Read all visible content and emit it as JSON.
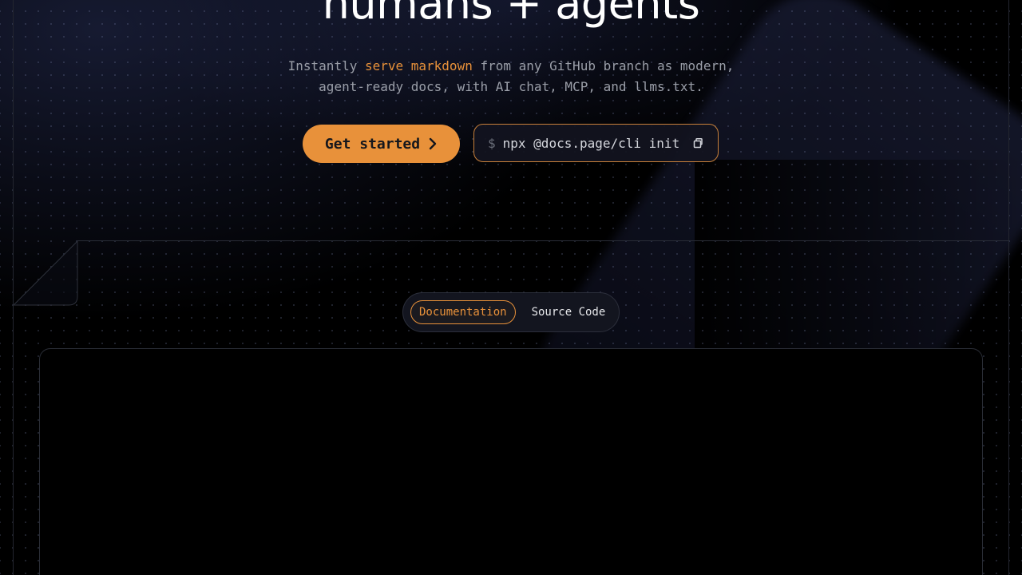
{
  "hero": {
    "title": "humans + agents",
    "subtitle_before": "Instantly ",
    "subtitle_highlight": "serve markdown",
    "subtitle_after_line1": " from any GitHub branch as modern,",
    "subtitle_line2": "agent-ready docs, with AI chat, MCP, and llms.txt."
  },
  "cta": {
    "label": "Get started",
    "icon": "chevron-right-icon"
  },
  "command": {
    "prompt": "$",
    "text": "npx @docs.page/cli init",
    "copy_icon": "copy-icon"
  },
  "view_toggle": {
    "options": [
      "Documentation",
      "Source Code"
    ],
    "selected": "Documentation"
  },
  "colors": {
    "accent": "#e8913a",
    "background": "#000000",
    "text": "#ffffff",
    "muted": "#9a9ea8"
  }
}
